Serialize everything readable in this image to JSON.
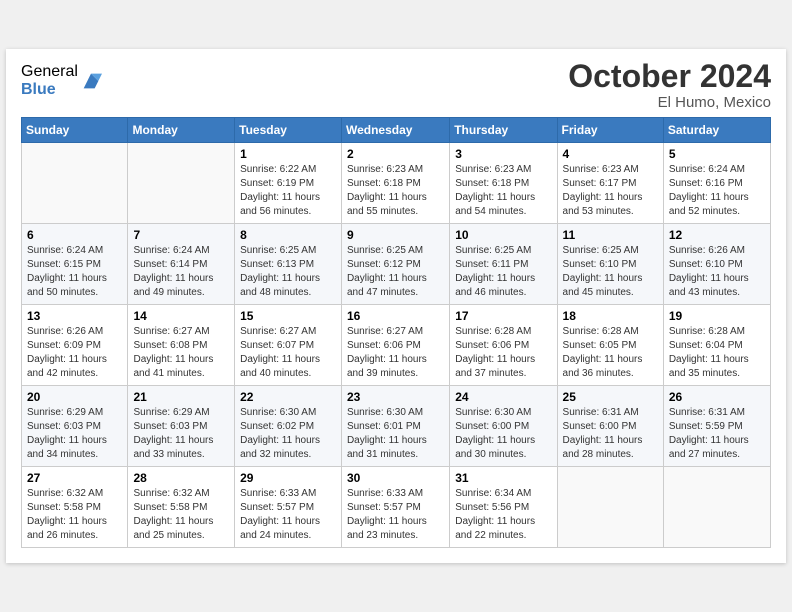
{
  "header": {
    "logo_general": "General",
    "logo_blue": "Blue",
    "month_title": "October 2024",
    "location": "El Humo, Mexico"
  },
  "weekdays": [
    "Sunday",
    "Monday",
    "Tuesday",
    "Wednesday",
    "Thursday",
    "Friday",
    "Saturday"
  ],
  "weeks": [
    [
      {
        "day": "",
        "info": ""
      },
      {
        "day": "",
        "info": ""
      },
      {
        "day": "1",
        "info": "Sunrise: 6:22 AM\nSunset: 6:19 PM\nDaylight: 11 hours and 56 minutes."
      },
      {
        "day": "2",
        "info": "Sunrise: 6:23 AM\nSunset: 6:18 PM\nDaylight: 11 hours and 55 minutes."
      },
      {
        "day": "3",
        "info": "Sunrise: 6:23 AM\nSunset: 6:18 PM\nDaylight: 11 hours and 54 minutes."
      },
      {
        "day": "4",
        "info": "Sunrise: 6:23 AM\nSunset: 6:17 PM\nDaylight: 11 hours and 53 minutes."
      },
      {
        "day": "5",
        "info": "Sunrise: 6:24 AM\nSunset: 6:16 PM\nDaylight: 11 hours and 52 minutes."
      }
    ],
    [
      {
        "day": "6",
        "info": "Sunrise: 6:24 AM\nSunset: 6:15 PM\nDaylight: 11 hours and 50 minutes."
      },
      {
        "day": "7",
        "info": "Sunrise: 6:24 AM\nSunset: 6:14 PM\nDaylight: 11 hours and 49 minutes."
      },
      {
        "day": "8",
        "info": "Sunrise: 6:25 AM\nSunset: 6:13 PM\nDaylight: 11 hours and 48 minutes."
      },
      {
        "day": "9",
        "info": "Sunrise: 6:25 AM\nSunset: 6:12 PM\nDaylight: 11 hours and 47 minutes."
      },
      {
        "day": "10",
        "info": "Sunrise: 6:25 AM\nSunset: 6:11 PM\nDaylight: 11 hours and 46 minutes."
      },
      {
        "day": "11",
        "info": "Sunrise: 6:25 AM\nSunset: 6:10 PM\nDaylight: 11 hours and 45 minutes."
      },
      {
        "day": "12",
        "info": "Sunrise: 6:26 AM\nSunset: 6:10 PM\nDaylight: 11 hours and 43 minutes."
      }
    ],
    [
      {
        "day": "13",
        "info": "Sunrise: 6:26 AM\nSunset: 6:09 PM\nDaylight: 11 hours and 42 minutes."
      },
      {
        "day": "14",
        "info": "Sunrise: 6:27 AM\nSunset: 6:08 PM\nDaylight: 11 hours and 41 minutes."
      },
      {
        "day": "15",
        "info": "Sunrise: 6:27 AM\nSunset: 6:07 PM\nDaylight: 11 hours and 40 minutes."
      },
      {
        "day": "16",
        "info": "Sunrise: 6:27 AM\nSunset: 6:06 PM\nDaylight: 11 hours and 39 minutes."
      },
      {
        "day": "17",
        "info": "Sunrise: 6:28 AM\nSunset: 6:06 PM\nDaylight: 11 hours and 37 minutes."
      },
      {
        "day": "18",
        "info": "Sunrise: 6:28 AM\nSunset: 6:05 PM\nDaylight: 11 hours and 36 minutes."
      },
      {
        "day": "19",
        "info": "Sunrise: 6:28 AM\nSunset: 6:04 PM\nDaylight: 11 hours and 35 minutes."
      }
    ],
    [
      {
        "day": "20",
        "info": "Sunrise: 6:29 AM\nSunset: 6:03 PM\nDaylight: 11 hours and 34 minutes."
      },
      {
        "day": "21",
        "info": "Sunrise: 6:29 AM\nSunset: 6:03 PM\nDaylight: 11 hours and 33 minutes."
      },
      {
        "day": "22",
        "info": "Sunrise: 6:30 AM\nSunset: 6:02 PM\nDaylight: 11 hours and 32 minutes."
      },
      {
        "day": "23",
        "info": "Sunrise: 6:30 AM\nSunset: 6:01 PM\nDaylight: 11 hours and 31 minutes."
      },
      {
        "day": "24",
        "info": "Sunrise: 6:30 AM\nSunset: 6:00 PM\nDaylight: 11 hours and 30 minutes."
      },
      {
        "day": "25",
        "info": "Sunrise: 6:31 AM\nSunset: 6:00 PM\nDaylight: 11 hours and 28 minutes."
      },
      {
        "day": "26",
        "info": "Sunrise: 6:31 AM\nSunset: 5:59 PM\nDaylight: 11 hours and 27 minutes."
      }
    ],
    [
      {
        "day": "27",
        "info": "Sunrise: 6:32 AM\nSunset: 5:58 PM\nDaylight: 11 hours and 26 minutes."
      },
      {
        "day": "28",
        "info": "Sunrise: 6:32 AM\nSunset: 5:58 PM\nDaylight: 11 hours and 25 minutes."
      },
      {
        "day": "29",
        "info": "Sunrise: 6:33 AM\nSunset: 5:57 PM\nDaylight: 11 hours and 24 minutes."
      },
      {
        "day": "30",
        "info": "Sunrise: 6:33 AM\nSunset: 5:57 PM\nDaylight: 11 hours and 23 minutes."
      },
      {
        "day": "31",
        "info": "Sunrise: 6:34 AM\nSunset: 5:56 PM\nDaylight: 11 hours and 22 minutes."
      },
      {
        "day": "",
        "info": ""
      },
      {
        "day": "",
        "info": ""
      }
    ]
  ]
}
